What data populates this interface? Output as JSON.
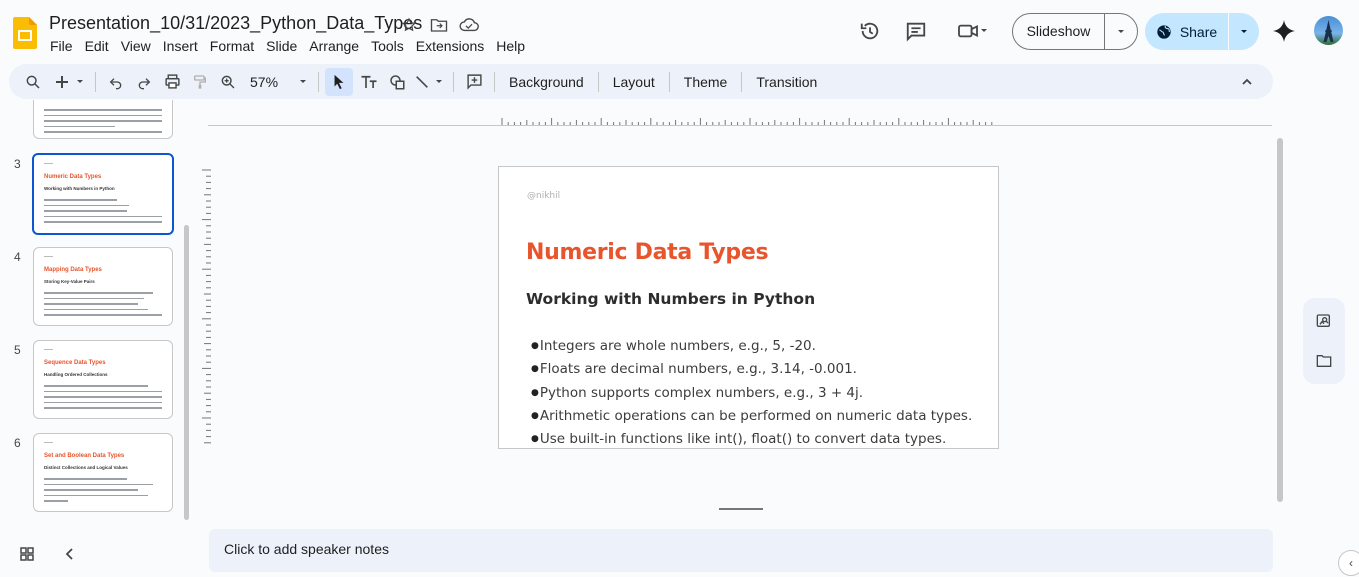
{
  "header": {
    "doc_title": "Presentation_10/31/2023_Python_Data_Types",
    "menu": [
      "File",
      "Edit",
      "View",
      "Insert",
      "Format",
      "Slide",
      "Arrange",
      "Tools",
      "Extensions",
      "Help"
    ],
    "slideshow_label": "Slideshow",
    "share_label": "Share"
  },
  "toolbar": {
    "zoom": "57%",
    "background_label": "Background",
    "layout_label": "Layout",
    "theme_label": "Theme",
    "transition_label": "Transition"
  },
  "filmstrip": {
    "slides": [
      {
        "number": "3",
        "title": "Numeric Data Types",
        "subtitle": "Working with Numbers in Python",
        "selected": true
      },
      {
        "number": "4",
        "title": "Mapping Data Types",
        "subtitle": "Storing Key-Value Pairs",
        "selected": false
      },
      {
        "number": "5",
        "title": "Sequence Data Types",
        "subtitle": "Handling Ordered Collections",
        "selected": false
      },
      {
        "number": "6",
        "title": "Set and Boolean Data Types",
        "subtitle": "Distinct Collections and Logical Values",
        "selected": false
      }
    ]
  },
  "slide": {
    "author": "@nikhil",
    "title": "Numeric Data Types",
    "subtitle": "Working with Numbers in Python",
    "bullets": [
      "Integers are whole numbers, e.g., 5, -20.",
      "Floats are decimal numbers, e.g., 3.14, -0.001.",
      "Python supports complex numbers, e.g., 3 + 4j.",
      "Arithmetic operations can be performed on numeric data types.",
      "Use built-in functions like int(), float() to convert data types."
    ]
  },
  "notes": {
    "placeholder": "Click to add speaker notes"
  },
  "colors": {
    "accent": "#0b57d0",
    "slide_title": "#e8552d",
    "share_bg": "#c2e7ff"
  }
}
